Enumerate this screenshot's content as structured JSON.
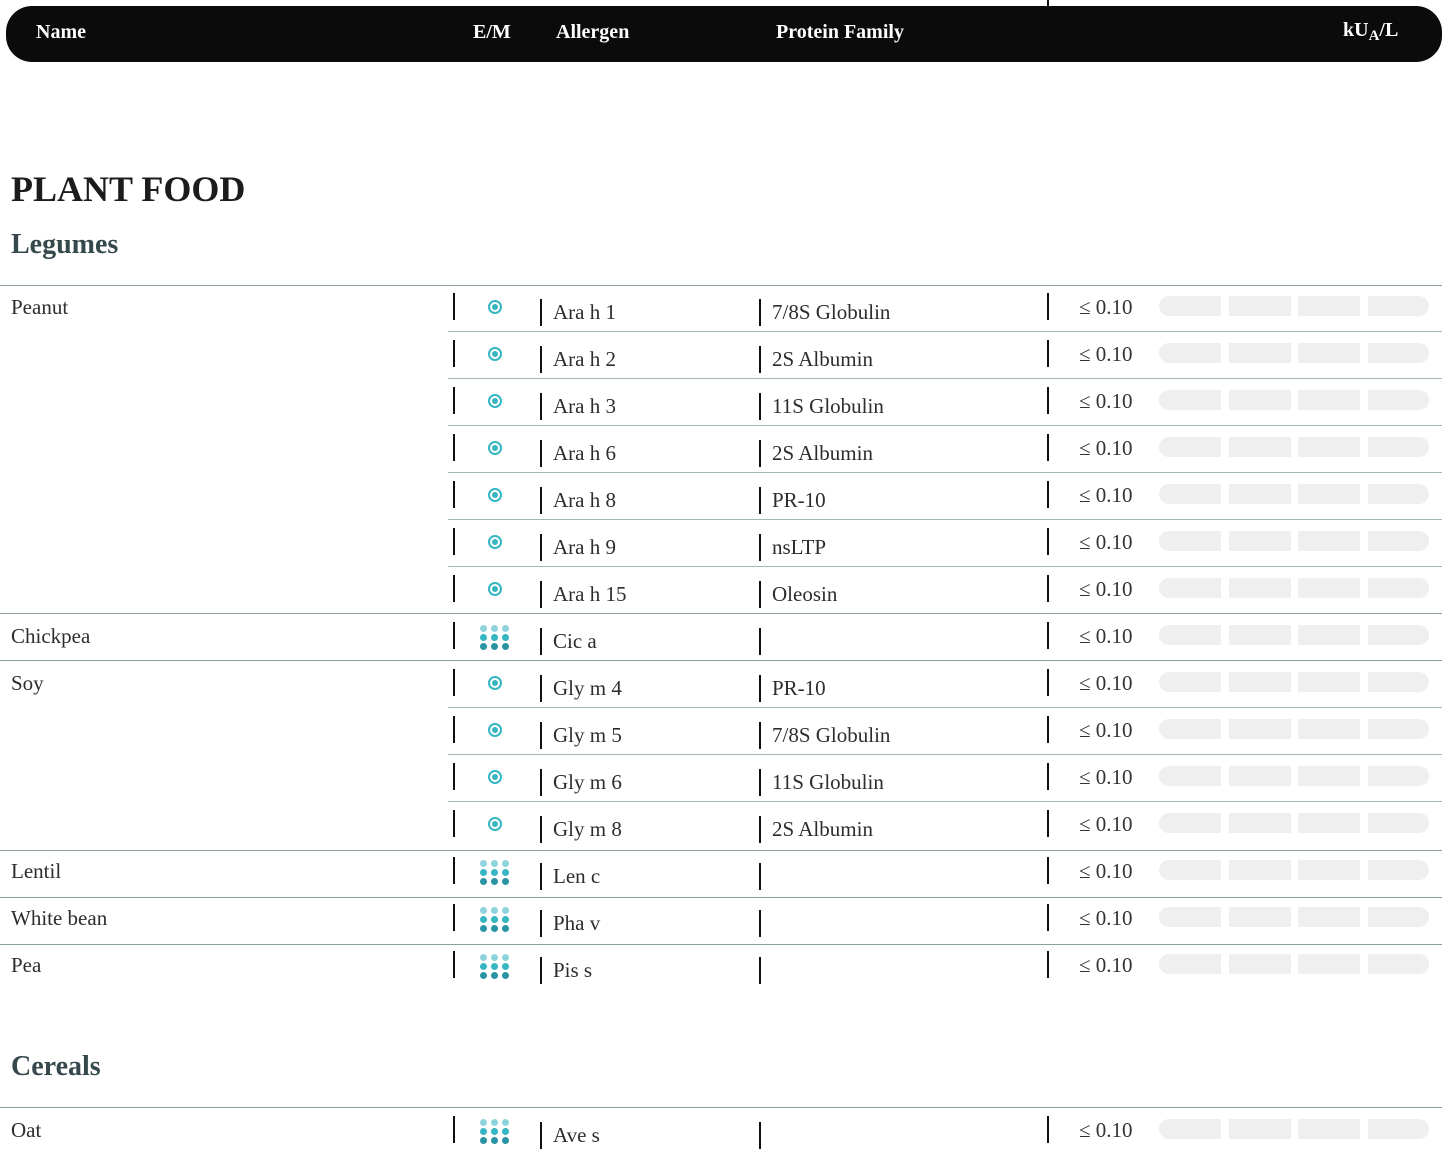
{
  "header": {
    "name": "Name",
    "em": "E/M",
    "allergen": "Allergen",
    "protein_family": "Protein Family",
    "unit_prefix": "kU",
    "unit_sub": "A",
    "unit_suffix": "/L"
  },
  "section_title": "PLANT FOOD",
  "subsections": {
    "legumes": "Legumes",
    "cereals": "Cereals"
  },
  "icons": {
    "extract": "extract-target-icon",
    "molecule": "molecular-dot-grid-icon"
  },
  "colors": {
    "header_bg": "#0b0b0b",
    "icon_teal": "#36b5c3",
    "icon_dark_teal": "#2a93a4",
    "icon_light_teal": "#8fd3dc",
    "scale_bar": "#efefef"
  },
  "rows": [
    {
      "name": "Peanut",
      "icon": "extract",
      "allergen": "Ara h 1",
      "family": "7/8S Globulin",
      "value": "≤ 0.10"
    },
    {
      "name": "",
      "icon": "extract",
      "allergen": "Ara h 2",
      "family": "2S Albumin",
      "value": "≤ 0.10"
    },
    {
      "name": "",
      "icon": "extract",
      "allergen": "Ara h 3",
      "family": "11S Globulin",
      "value": "≤ 0.10"
    },
    {
      "name": "",
      "icon": "extract",
      "allergen": "Ara h 6",
      "family": "2S Albumin",
      "value": "≤ 0.10"
    },
    {
      "name": "",
      "icon": "extract",
      "allergen": "Ara h 8",
      "family": "PR-10",
      "value": "≤ 0.10"
    },
    {
      "name": "",
      "icon": "extract",
      "allergen": "Ara h 9",
      "family": "nsLTP",
      "value": "≤ 0.10"
    },
    {
      "name": "",
      "icon": "extract",
      "allergen": "Ara h 15",
      "family": "Oleosin",
      "value": "≤ 0.10"
    },
    {
      "name": "Chickpea",
      "icon": "molecule",
      "allergen": "Cic a",
      "family": "",
      "value": "≤ 0.10"
    },
    {
      "name": "Soy",
      "icon": "extract",
      "allergen": "Gly m 4",
      "family": "PR-10",
      "value": "≤ 0.10"
    },
    {
      "name": "",
      "icon": "extract",
      "allergen": "Gly m 5",
      "family": "7/8S Globulin",
      "value": "≤ 0.10"
    },
    {
      "name": "",
      "icon": "extract",
      "allergen": "Gly m 6",
      "family": "11S Globulin",
      "value": "≤ 0.10"
    },
    {
      "name": "",
      "icon": "extract",
      "allergen": "Gly m 8",
      "family": "2S Albumin",
      "value": "≤ 0.10"
    },
    {
      "name": "Lentil",
      "icon": "molecule",
      "allergen": "Len c",
      "family": "",
      "value": "≤ 0.10"
    },
    {
      "name": "White bean",
      "icon": "molecule",
      "allergen": "Pha v",
      "family": "",
      "value": "≤ 0.10"
    },
    {
      "name": "Pea",
      "icon": "molecule",
      "allergen": "Pis s",
      "family": "",
      "value": "≤ 0.10"
    },
    {
      "name": "Oat",
      "icon": "molecule",
      "allergen": "Ave s",
      "family": "",
      "value": "≤ 0.10"
    }
  ]
}
